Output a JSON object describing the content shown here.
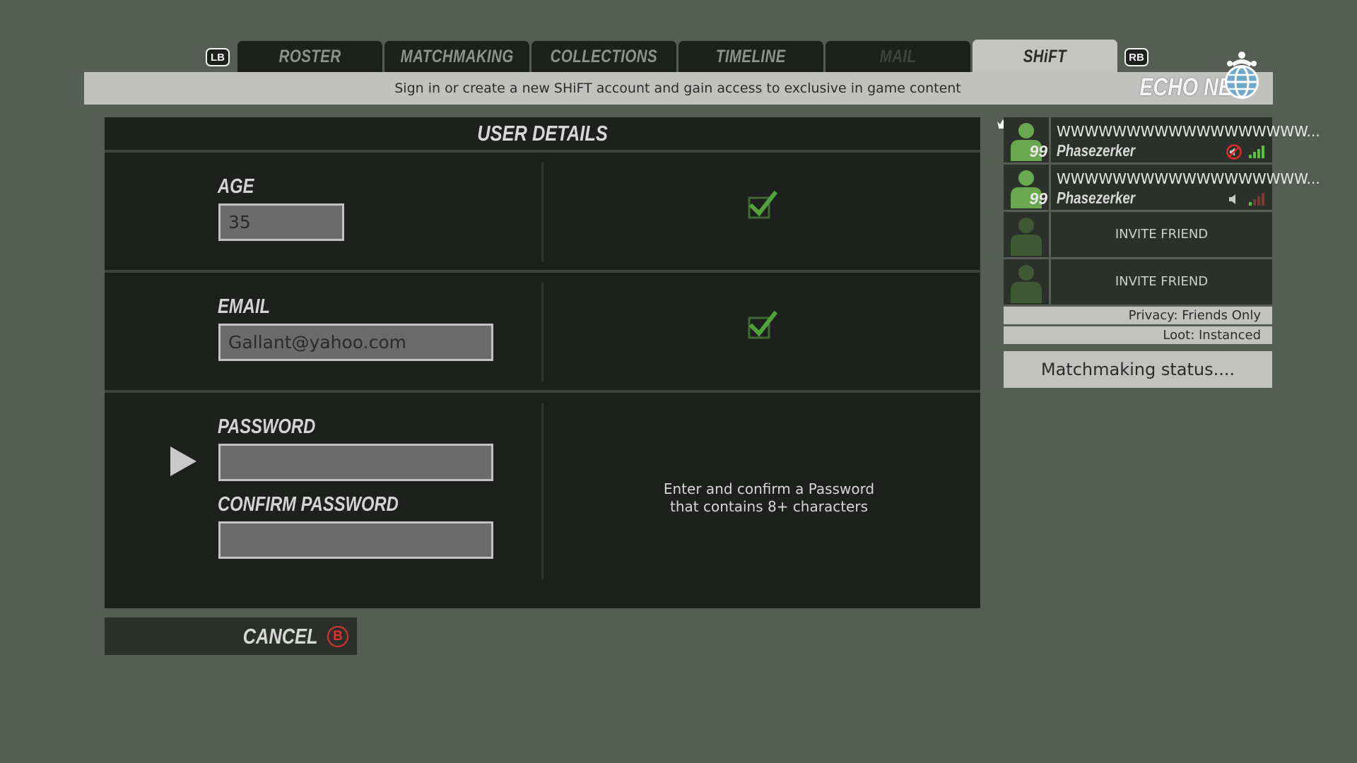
{
  "tabbar": {
    "left_bumper": "LB",
    "right_bumper": "RB",
    "tabs": [
      {
        "label": "ROSTER",
        "state": "normal"
      },
      {
        "label": "MATCHMAKING",
        "state": "normal"
      },
      {
        "label": "COLLECTIONS",
        "state": "normal"
      },
      {
        "label": "TIMELINE",
        "state": "normal"
      },
      {
        "label": "MAIL",
        "state": "disabled"
      },
      {
        "label": "SHiFT",
        "state": "active"
      }
    ]
  },
  "infobar": {
    "message": "Sign in or create a new SHiFT account and gain access to exclusive in game content",
    "brand": "ECHO NET",
    "brand_icon": "echo-globe-icon"
  },
  "user_details": {
    "title": "USER DETAILS",
    "age": {
      "label": "AGE",
      "value": "35",
      "valid": true
    },
    "email": {
      "label": "EMAIL",
      "value": "Gallant@yahoo.com",
      "valid": true
    },
    "password": {
      "label": "PASSWORD",
      "value": ""
    },
    "confirm_password": {
      "label": "CONFIRM PASSWORD",
      "value": ""
    },
    "password_hint_line1": "Enter and confirm a Password",
    "password_hint_line2": "that contains 8+ characters"
  },
  "cancel": {
    "label": "CANCEL",
    "button_glyph": "B"
  },
  "party": {
    "members": [
      {
        "gamertag": "WWWWWWWWWWWWWWWWWW...",
        "character": "Phasezerker",
        "level": "99",
        "leader": true,
        "voice": "muted",
        "signal_bars": 4
      },
      {
        "gamertag": "WWWWWWWWWWWWWWWWWW...",
        "character": "Phasezerker",
        "level": "99",
        "leader": false,
        "voice": "speaker",
        "signal_bars": 1
      }
    ],
    "invite_slots": [
      "INVITE FRIEND",
      "INVITE FRIEND"
    ],
    "privacy": "Privacy: Friends Only",
    "loot": "Loot: Instanced",
    "matchmaking_status": "Matchmaking status...."
  },
  "colors": {
    "background": "#565d55",
    "panel": "#1e201e",
    "accent_green": "#5a9a44",
    "check_green": "#4fa33a",
    "muted_red": "#e02a2a"
  }
}
